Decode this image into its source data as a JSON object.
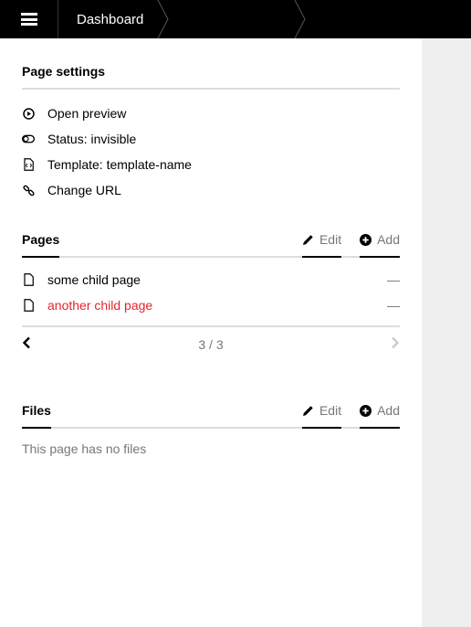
{
  "topbar": {
    "breadcrumb": [
      "Dashboard"
    ]
  },
  "settings": {
    "title": "Page settings",
    "items": [
      {
        "icon": "preview-icon",
        "label": "Open preview"
      },
      {
        "icon": "toggle-icon",
        "label": "Status: invisible"
      },
      {
        "icon": "file-code-icon",
        "label": "Template: template-name"
      },
      {
        "icon": "link-icon",
        "label": "Change URL"
      }
    ]
  },
  "pages": {
    "title": "Pages",
    "edit_label": "Edit",
    "add_label": "Add",
    "items": [
      {
        "label": "some child page",
        "status": "—",
        "color": "#000000"
      },
      {
        "label": "another child page",
        "status": "—",
        "color": "#e3242b"
      }
    ],
    "pagination": {
      "text": "3 / 3"
    }
  },
  "files": {
    "title": "Files",
    "edit_label": "Edit",
    "add_label": "Add",
    "empty_text": "This page has no files"
  }
}
